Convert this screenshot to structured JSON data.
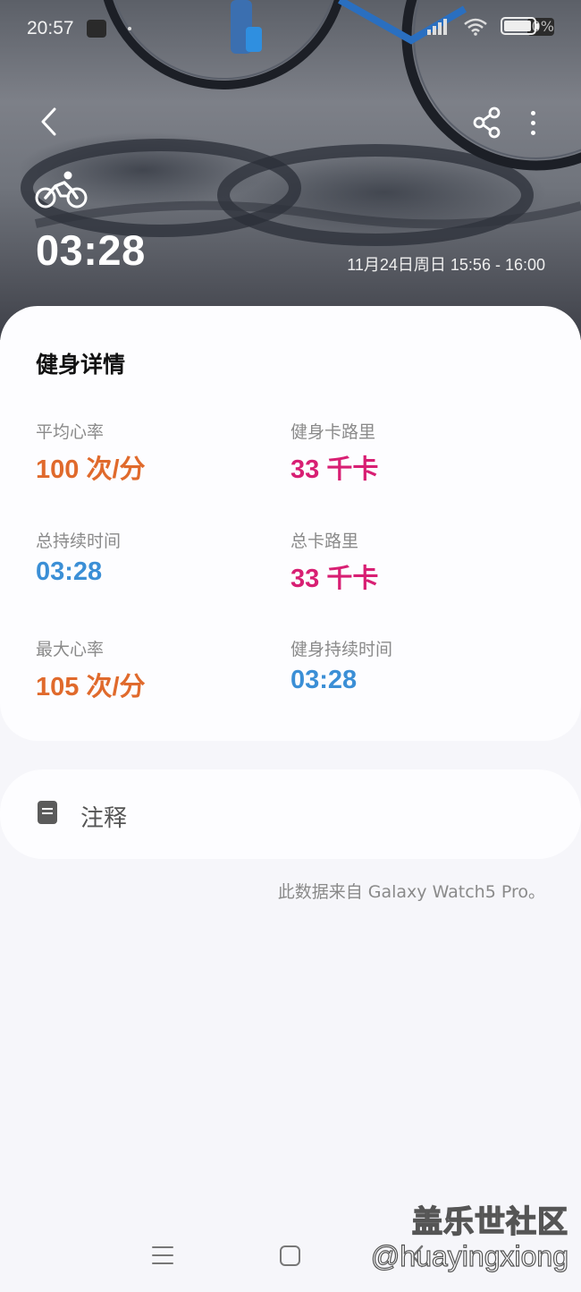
{
  "status_bar": {
    "time": "20:57",
    "battery": "100%"
  },
  "header": {
    "icons": {
      "back": "back-arrow-icon",
      "share": "share-icon",
      "more": "more-vertical-icon",
      "activity": "cycling-icon"
    },
    "duration": "03:28",
    "date_range": "11月24日周日 15:56 - 16:00"
  },
  "details": {
    "title": "健身详情",
    "stats": [
      {
        "label": "平均心率",
        "value": "100 次/分",
        "color": "#e06a2c"
      },
      {
        "label": "健身卡路里",
        "value": "33 千卡",
        "color": "#d81f73"
      },
      {
        "label": "总持续时间",
        "value": "03:28",
        "color": "#3b8fd6"
      },
      {
        "label": "总卡路里",
        "value": "33 千卡",
        "color": "#d81f73"
      },
      {
        "label": "最大心率",
        "value": "105 次/分",
        "color": "#e06a2c"
      },
      {
        "label": "健身持续时间",
        "value": "03:28",
        "color": "#3b8fd6"
      }
    ]
  },
  "notes": {
    "label": "注释",
    "icon": "note-icon"
  },
  "source": "此数据来自 Galaxy Watch5 Pro。",
  "nav": {
    "recent": "recent-apps-icon",
    "home": "home-icon",
    "back": "nav-back-icon"
  },
  "watermark": {
    "line1": "盖乐世社区",
    "line2": "@huayingxiong"
  }
}
